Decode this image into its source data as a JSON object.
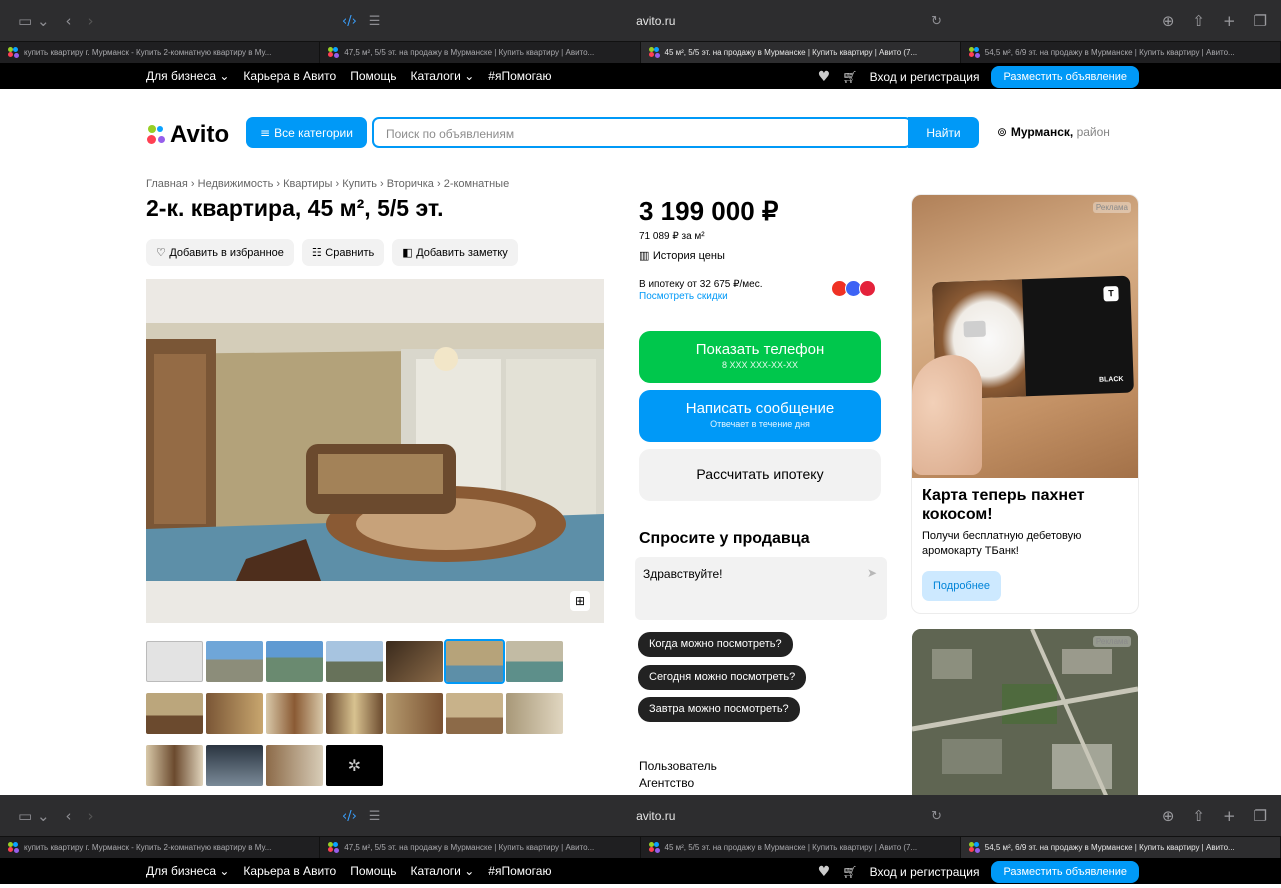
{
  "browser": {
    "url": "avito.ru",
    "tabs": [
      {
        "title": "купить квартиру г. Мурманск - Купить 2-комнатную квартиру в Му...",
        "active": false
      },
      {
        "title": "47,5 м², 5/5 эт. на продажу в Мурманске | Купить квартиру | Авито...",
        "active": false
      },
      {
        "title": "45 м², 5/5 эт. на продажу в Мурманске | Купить квартиру | Авито (7...",
        "active": true
      },
      {
        "title": "54,5 м², 6/9 эт. на продажу в Мурманске | Купить квартиру | Авито...",
        "active": false
      }
    ],
    "tabs_bottom": [
      {
        "title": "купить квартиру г. Мурманск - Купить 2-комнатную квартиру в Му...",
        "active": false
      },
      {
        "title": "47,5 м², 5/5 эт. на продажу в Мурманске | Купить квартиру | Авито...",
        "active": false
      },
      {
        "title": "45 м², 5/5 эт. на продажу в Мурманске | Купить квартиру | Авито (7...",
        "active": false
      },
      {
        "title": "54,5 м², 6/9 эт. на продажу в Мурманске | Купить квартиру | Авито...",
        "active": true
      }
    ]
  },
  "topnav": {
    "links": [
      "Для бизнеса ⌄",
      "Карьера в Авито",
      "Помощь",
      "Каталоги ⌄",
      "#яПомогаю"
    ],
    "login": "Вход и регистрация",
    "post_ad": "Разместить объявление"
  },
  "header": {
    "logo": "Avito",
    "all_categories": "Все категории",
    "search_placeholder": "Поиск по объявлениям",
    "find": "Найти",
    "city": "Мурманск,",
    "district": "район"
  },
  "listing": {
    "breadcrumbs": "Главная › Недвижимость › Квартиры › Купить › Вторичка › 2-комнатные",
    "title": "2-к. квартира, 45 м², 5/5 эт.",
    "add_favorite": "Добавить в избранное",
    "compare": "Сравнить",
    "add_note": "Добавить заметку",
    "price": "3 199 000 ₽",
    "price_per_m2": "71 089 ₽ за м²",
    "price_history": "История цены",
    "mortgage": "В ипотеку от 32 675 ₽/мес.",
    "discounts": "Посмотреть скидки",
    "show_phone": "Показать телефон",
    "phone_mask": "8 XXX XXX-XX-XX",
    "write_message": "Написать сообщение",
    "replies": "Отвечает в течение дня",
    "calc_mortgage": "Рассчитать ипотеку",
    "ask_seller": "Спросите у продавца",
    "message_default": "Здравствуйте!",
    "quick_questions": [
      "Когда можно посмотреть?",
      "Сегодня можно посмотреть?",
      "Завтра можно посмотреть?"
    ],
    "seller_name": "Пользователь",
    "seller_type": "Агентство"
  },
  "ad": {
    "label": "Реклама",
    "card_brand": "BLACK",
    "title": "Карта теперь пахнет кокосом!",
    "text": "Получи бесплатную дебетовую аромокарту ТБанк!",
    "button": "Подробнее",
    "label2": "Реклама"
  },
  "colors": {
    "accent": "#0099f7",
    "green": "#00c74c",
    "chip": "#222222"
  }
}
